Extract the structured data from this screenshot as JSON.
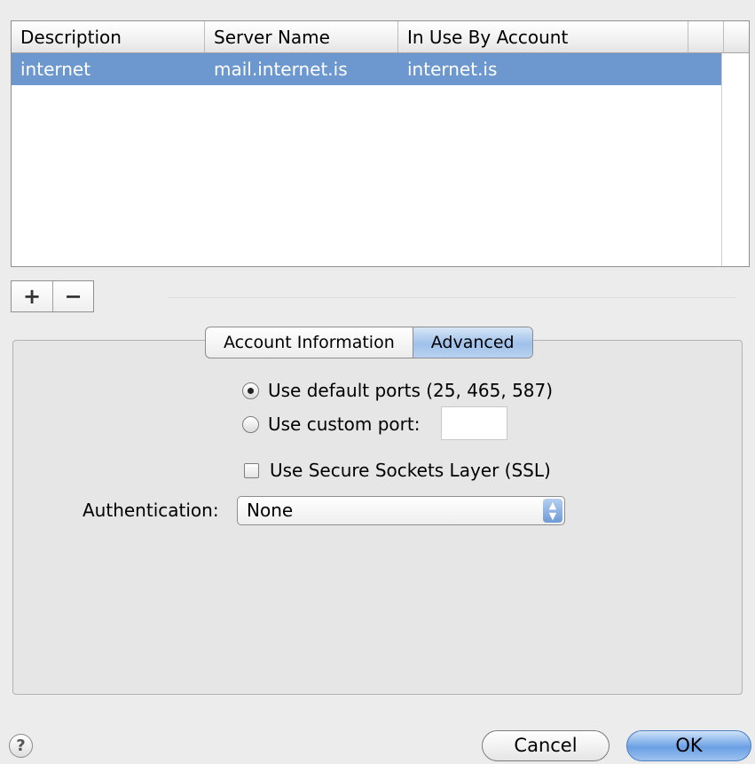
{
  "server_table": {
    "columns": [
      "Description",
      "Server Name",
      "In Use By Account"
    ],
    "rows": [
      {
        "description": "internet",
        "server_name": "mail.internet.is",
        "account": "internet.is",
        "selected": true
      }
    ]
  },
  "list_controls": {
    "add_label": "+",
    "remove_label": "−"
  },
  "tabs": [
    {
      "label": "Account Information",
      "active": false
    },
    {
      "label": "Advanced",
      "active": true
    }
  ],
  "advanced": {
    "default_ports_label": "Use default ports (25, 465, 587)",
    "default_ports_selected": true,
    "custom_port_label": "Use custom port:",
    "custom_port_value": "",
    "ssl_label": "Use Secure Sockets Layer (SSL)",
    "ssl_checked": false,
    "auth_label": "Authentication:",
    "auth_value": "None"
  },
  "buttons": {
    "help": "?",
    "cancel": "Cancel",
    "ok": "OK"
  },
  "colors": {
    "selection": "#6d98cf",
    "accent": "#6aa0e4"
  }
}
